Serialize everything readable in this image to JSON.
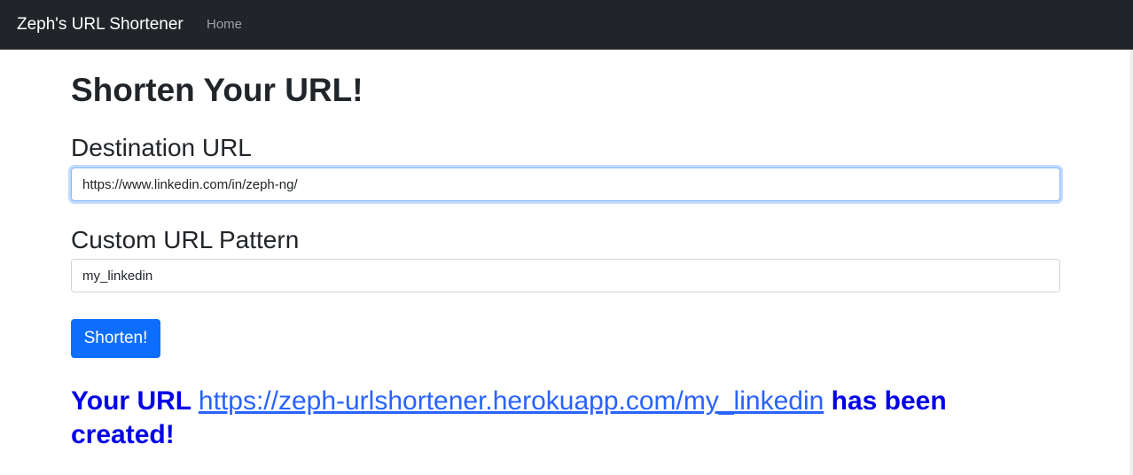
{
  "navbar": {
    "brand": "Zeph's URL Shortener",
    "links": [
      "Home"
    ]
  },
  "main": {
    "title": "Shorten Your URL!",
    "destination": {
      "label": "Destination URL",
      "value": "https://www.linkedin.com/in/zeph-ng/"
    },
    "custom": {
      "label": "Custom URL Pattern",
      "value": "my_linkedin"
    },
    "submit_label": "Shorten!",
    "result": {
      "prefix": "Your URL",
      "link": "https://zeph-urlshortener.herokuapp.com/my_linkedin",
      "suffix": "has been created!"
    }
  },
  "colors": {
    "navbar_bg": "#212529",
    "primary": "#0d6efd",
    "result_text": "#0000e6",
    "result_link": "#2962ff"
  }
}
